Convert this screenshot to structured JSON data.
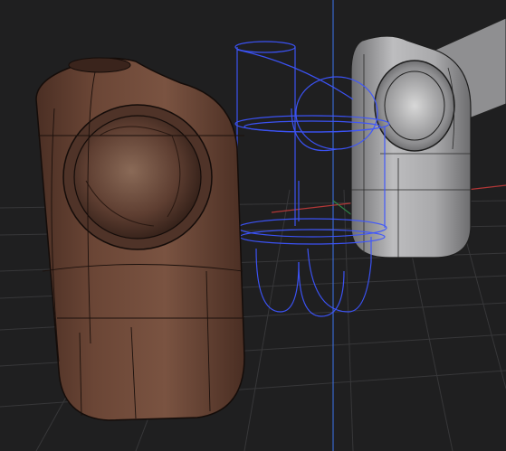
{
  "viewport": {
    "background_color": "#1f1f20",
    "grid_color": "#3a3a3c",
    "axis_x_color": "#c23a3a",
    "axis_y_color": "#2f8f4a",
    "axis_z_color": "#3b6fe0"
  },
  "objects": [
    {
      "name": "brown-shaded-model",
      "material": "solid",
      "color": "#6a4636"
    },
    {
      "name": "blue-wireframe-model",
      "material": "wireframe",
      "color": "#3d55ff"
    },
    {
      "name": "gray-shaded-model",
      "material": "solid",
      "color": "#a9a9aa"
    }
  ]
}
